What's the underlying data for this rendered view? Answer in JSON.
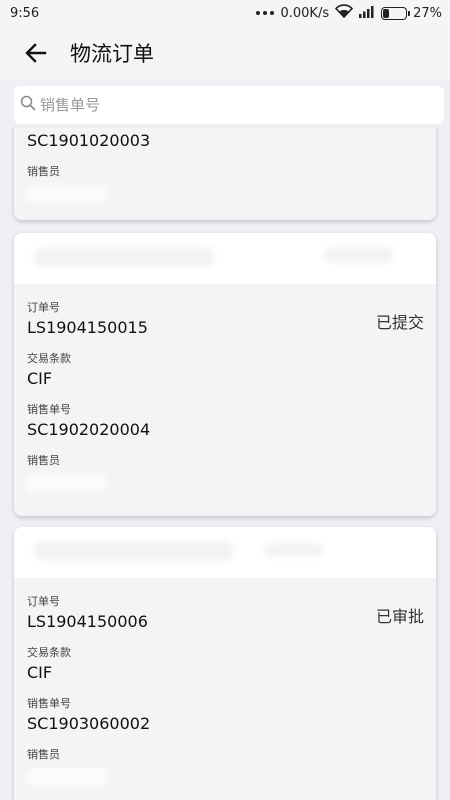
{
  "status_bar": {
    "time": "9:56",
    "network_speed": "0.00K/s",
    "battery": "27%",
    "battery_level": 0.27
  },
  "app_bar": {
    "title": "物流订单",
    "back_icon": "arrow-left-icon"
  },
  "search": {
    "placeholder": "销售单号",
    "value": "",
    "icon": "search-icon"
  },
  "labels": {
    "order_no": "订单号",
    "trade_terms": "交易条款",
    "sales_order_no": "销售单号",
    "salesperson": "销售员"
  },
  "orders": [
    {
      "sales_order_no": "SC1901020003"
    },
    {
      "order_no": "LS1904150015",
      "status": "已提交",
      "trade_terms": "CIF",
      "sales_order_no": "SC1902020004"
    },
    {
      "order_no": "LS1904150006",
      "status": "已审批",
      "trade_terms": "CIF",
      "sales_order_no": "SC1903060002"
    }
  ],
  "colors": {
    "background": "#efeff4",
    "card": "#ffffff",
    "card_body": "#f4f4f6"
  }
}
